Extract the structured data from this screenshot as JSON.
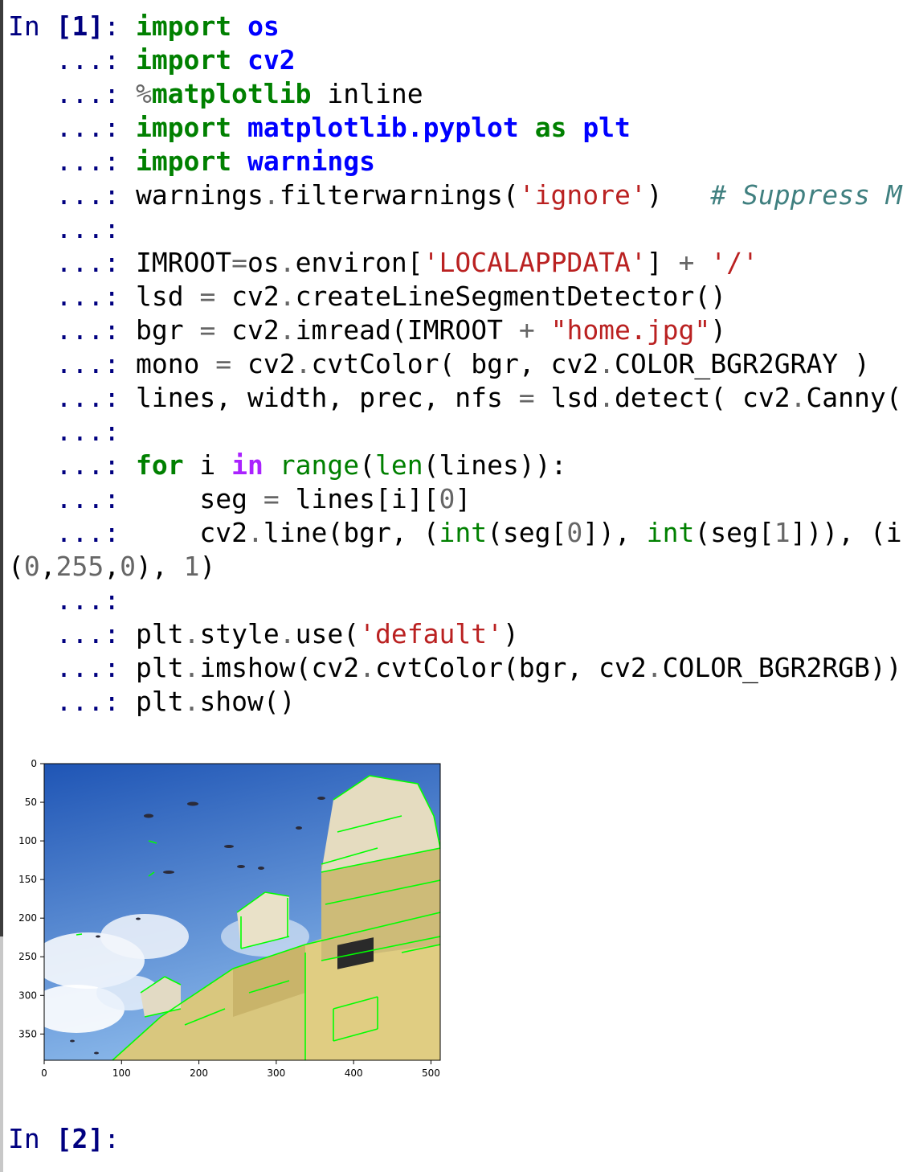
{
  "prompts": {
    "in_label": "In ",
    "first_number": "[1]",
    "second_number": "[2]",
    "colon": ":",
    "continuation": "   ...: "
  },
  "code_lines": [
    [
      {
        "c": "kw",
        "t": "import"
      },
      {
        "c": "plain",
        "t": " "
      },
      {
        "c": "mod",
        "t": "os"
      }
    ],
    [
      {
        "c": "kw",
        "t": "import"
      },
      {
        "c": "plain",
        "t": " "
      },
      {
        "c": "mod",
        "t": "cv2"
      }
    ],
    [
      {
        "c": "op",
        "t": "%"
      },
      {
        "c": "kw",
        "t": "matplotlib"
      },
      {
        "c": "plain",
        "t": " inline"
      }
    ],
    [
      {
        "c": "kw",
        "t": "import"
      },
      {
        "c": "plain",
        "t": " "
      },
      {
        "c": "mod",
        "t": "matplotlib.pyplot"
      },
      {
        "c": "plain",
        "t": " "
      },
      {
        "c": "kw",
        "t": "as"
      },
      {
        "c": "plain",
        "t": " "
      },
      {
        "c": "mod",
        "t": "plt"
      }
    ],
    [
      {
        "c": "kw",
        "t": "import"
      },
      {
        "c": "plain",
        "t": " "
      },
      {
        "c": "mod",
        "t": "warnings"
      }
    ],
    [
      {
        "c": "plain",
        "t": "warnings"
      },
      {
        "c": "op",
        "t": "."
      },
      {
        "c": "plain",
        "t": "filterwarnings("
      },
      {
        "c": "str",
        "t": "'ignore'"
      },
      {
        "c": "plain",
        "t": ")   "
      },
      {
        "c": "cm",
        "t": "# Suppress M"
      }
    ],
    [],
    [
      {
        "c": "plain",
        "t": "IMROOT"
      },
      {
        "c": "op",
        "t": "="
      },
      {
        "c": "plain",
        "t": "os"
      },
      {
        "c": "op",
        "t": "."
      },
      {
        "c": "plain",
        "t": "environ["
      },
      {
        "c": "str",
        "t": "'LOCALAPPDATA'"
      },
      {
        "c": "plain",
        "t": "] "
      },
      {
        "c": "op",
        "t": "+"
      },
      {
        "c": "plain",
        "t": " "
      },
      {
        "c": "str",
        "t": "'/'"
      }
    ],
    [
      {
        "c": "plain",
        "t": "lsd "
      },
      {
        "c": "op",
        "t": "="
      },
      {
        "c": "plain",
        "t": " cv2"
      },
      {
        "c": "op",
        "t": "."
      },
      {
        "c": "plain",
        "t": "createLineSegmentDetector()"
      }
    ],
    [
      {
        "c": "plain",
        "t": "bgr "
      },
      {
        "c": "op",
        "t": "="
      },
      {
        "c": "plain",
        "t": " cv2"
      },
      {
        "c": "op",
        "t": "."
      },
      {
        "c": "plain",
        "t": "imread(IMROOT "
      },
      {
        "c": "op",
        "t": "+"
      },
      {
        "c": "plain",
        "t": " "
      },
      {
        "c": "str",
        "t": "\"home.jpg\""
      },
      {
        "c": "plain",
        "t": ")"
      }
    ],
    [
      {
        "c": "plain",
        "t": "mono "
      },
      {
        "c": "op",
        "t": "="
      },
      {
        "c": "plain",
        "t": " cv2"
      },
      {
        "c": "op",
        "t": "."
      },
      {
        "c": "plain",
        "t": "cvtColor( bgr, cv2"
      },
      {
        "c": "op",
        "t": "."
      },
      {
        "c": "plain",
        "t": "COLOR_BGR2GRAY )"
      }
    ],
    [
      {
        "c": "plain",
        "t": "lines, width, prec, nfs "
      },
      {
        "c": "op",
        "t": "="
      },
      {
        "c": "plain",
        "t": " lsd"
      },
      {
        "c": "op",
        "t": "."
      },
      {
        "c": "plain",
        "t": "detect( cv2"
      },
      {
        "c": "op",
        "t": "."
      },
      {
        "c": "plain",
        "t": "Canny("
      }
    ],
    [],
    [
      {
        "c": "kw",
        "t": "for"
      },
      {
        "c": "plain",
        "t": " i "
      },
      {
        "c": "inkw",
        "t": "in"
      },
      {
        "c": "plain",
        "t": " "
      },
      {
        "c": "bi",
        "t": "range"
      },
      {
        "c": "plain",
        "t": "("
      },
      {
        "c": "bi",
        "t": "len"
      },
      {
        "c": "plain",
        "t": "(lines)):"
      }
    ],
    [
      {
        "c": "plain",
        "t": "    seg "
      },
      {
        "c": "op",
        "t": "="
      },
      {
        "c": "plain",
        "t": " lines[i]["
      },
      {
        "c": "num",
        "t": "0"
      },
      {
        "c": "plain",
        "t": "]"
      }
    ],
    [
      {
        "c": "plain",
        "t": "    cv2"
      },
      {
        "c": "op",
        "t": "."
      },
      {
        "c": "plain",
        "t": "line(bgr, ("
      },
      {
        "c": "bi",
        "t": "int"
      },
      {
        "c": "plain",
        "t": "(seg["
      },
      {
        "c": "num",
        "t": "0"
      },
      {
        "c": "plain",
        "t": "]), "
      },
      {
        "c": "bi",
        "t": "int"
      },
      {
        "c": "plain",
        "t": "(seg["
      },
      {
        "c": "num",
        "t": "1"
      },
      {
        "c": "plain",
        "t": "])), (i"
      }
    ]
  ],
  "wrapped_line": [
    {
      "c": "plain",
      "t": "("
    },
    {
      "c": "num",
      "t": "0"
    },
    {
      "c": "plain",
      "t": ","
    },
    {
      "c": "num",
      "t": "255"
    },
    {
      "c": "plain",
      "t": ","
    },
    {
      "c": "num",
      "t": "0"
    },
    {
      "c": "plain",
      "t": "), "
    },
    {
      "c": "num",
      "t": "1"
    },
    {
      "c": "plain",
      "t": ")"
    }
  ],
  "code_lines_after": [
    [],
    [
      {
        "c": "plain",
        "t": "plt"
      },
      {
        "c": "op",
        "t": "."
      },
      {
        "c": "plain",
        "t": "style"
      },
      {
        "c": "op",
        "t": "."
      },
      {
        "c": "plain",
        "t": "use("
      },
      {
        "c": "str",
        "t": "'default'"
      },
      {
        "c": "plain",
        "t": ")"
      }
    ],
    [
      {
        "c": "plain",
        "t": "plt"
      },
      {
        "c": "op",
        "t": "."
      },
      {
        "c": "plain",
        "t": "imshow(cv2"
      },
      {
        "c": "op",
        "t": "."
      },
      {
        "c": "plain",
        "t": "cvtColor(bgr, cv2"
      },
      {
        "c": "op",
        "t": "."
      },
      {
        "c": "plain",
        "t": "COLOR_BGR2RGB))"
      }
    ],
    [
      {
        "c": "plain",
        "t": "plt"
      },
      {
        "c": "op",
        "t": "."
      },
      {
        "c": "plain",
        "t": "show()"
      }
    ]
  ],
  "chart_data": {
    "type": "image",
    "x_ticks": [
      0,
      100,
      200,
      300,
      400,
      500
    ],
    "y_ticks": [
      0,
      50,
      100,
      150,
      200,
      250,
      300,
      350
    ],
    "xlim": [
      0,
      512
    ],
    "ylim": [
      384,
      0
    ]
  },
  "colors": {
    "sky_top": "#1f55b5",
    "sky_bottom": "#7fb0e6",
    "building": "#d9c77e",
    "line_segments": "#00ff00"
  }
}
